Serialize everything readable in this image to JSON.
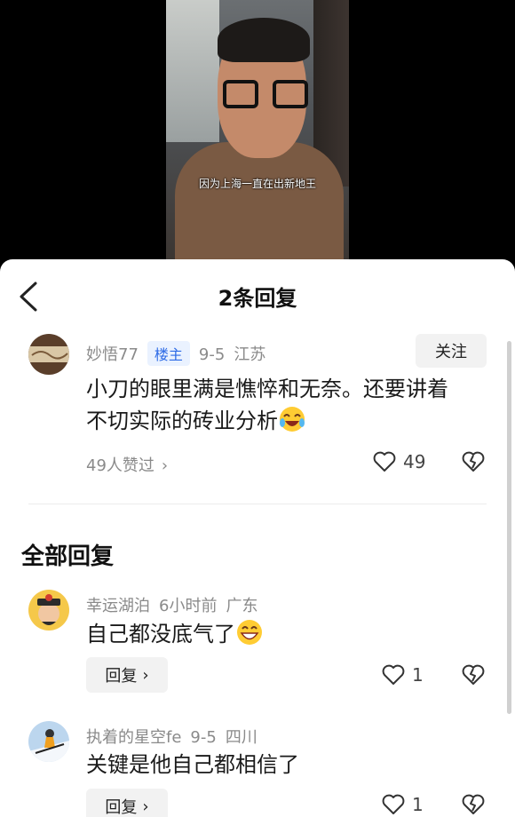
{
  "video": {
    "subtitle": "因为上海一直在出新地王"
  },
  "sheet": {
    "title": "2条回复",
    "main_comment": {
      "username": "妙悟77",
      "badge": "楼主",
      "date": "9-5",
      "location": "江苏",
      "follow_label": "关注",
      "text_line1": "小刀的眼里满是憔悴和无奈。还要讲着",
      "text_line2": "不切实际的砖业分析",
      "emoji": "laugh-cry-emoji",
      "likes_summary": "49人赞过",
      "like_count": "49"
    },
    "section_title": "全部回复",
    "replies": [
      {
        "username": "幸运湖泊",
        "time": "6小时前",
        "location": "广东",
        "text": "自己都没底气了",
        "emoji": "grin-emoji",
        "reply_label": "回复",
        "like_count": "1"
      },
      {
        "username": "执着的星空fe",
        "time": "9-5",
        "location": "四川",
        "text": "关键是他自己都相信了",
        "reply_label": "回复",
        "like_count": "1"
      }
    ]
  }
}
